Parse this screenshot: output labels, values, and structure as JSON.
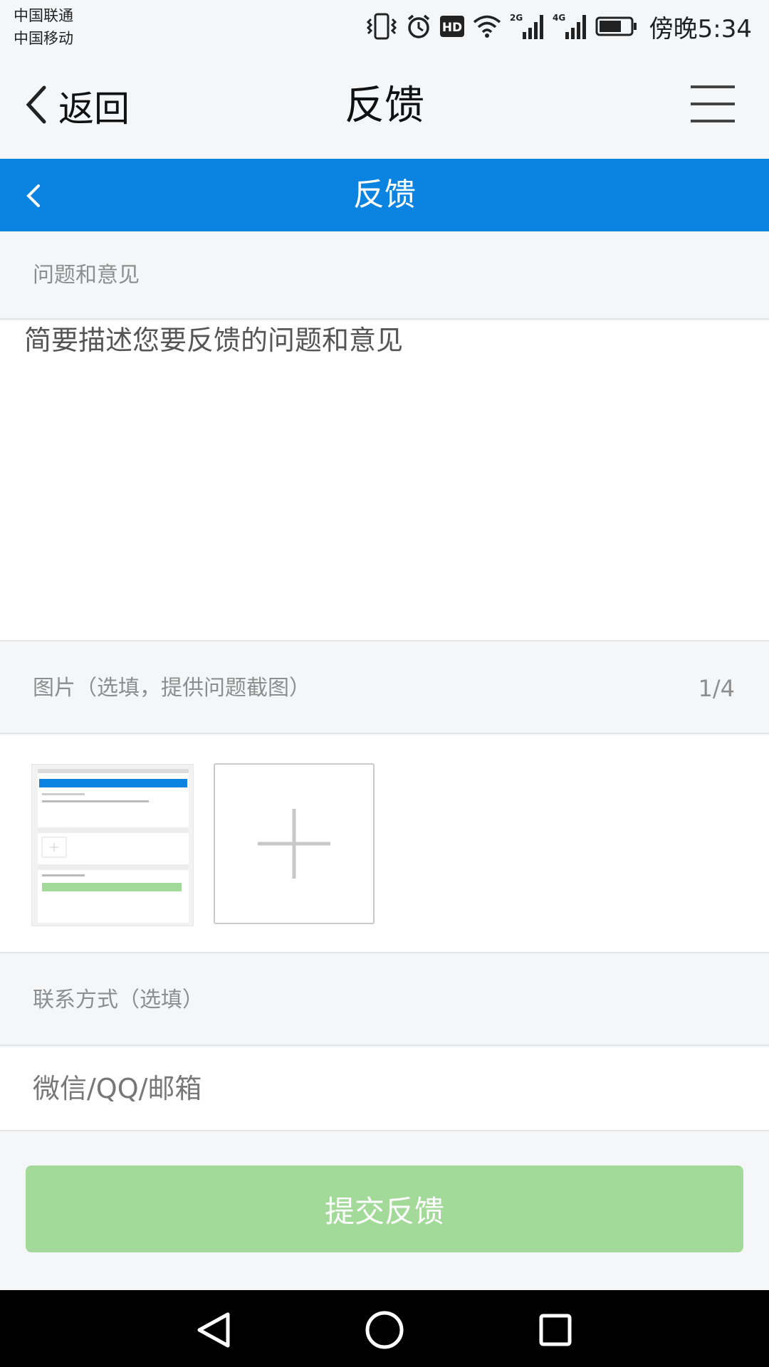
{
  "status_bar": {
    "carrier_1": "中国联通",
    "carrier_2": "中国移动",
    "hd_badge": "HD",
    "net_2g": "2G",
    "net_4g": "4G",
    "time": "傍晚5:34"
  },
  "browser_nav": {
    "back_label": "返回",
    "title": "反馈"
  },
  "header": {
    "title": "反馈"
  },
  "form": {
    "issues_label": "问题和意见",
    "issues_placeholder": "简要描述您要反馈的问题和意见",
    "images_label": "图片（选填，提供问题截图）",
    "images_count": "1/4",
    "contact_label": "联系方式（选填）",
    "contact_placeholder": "微信/QQ/邮箱",
    "submit_label": "提交反馈"
  },
  "icons": {
    "vibrate": "vibrate-icon",
    "alarm": "alarm-icon",
    "wifi": "wifi-icon",
    "signal": "signal-icon",
    "battery": "battery-icon",
    "back": "chevron-left-icon",
    "menu": "hamburger-menu-icon",
    "add": "plus-icon",
    "android_back": "triangle-back-icon",
    "android_home": "circle-home-icon",
    "android_recent": "square-recent-icon"
  },
  "colors": {
    "header_blue": "#0a84e0",
    "submit_green": "#a3d999",
    "page_bg": "#f5f6f7"
  }
}
